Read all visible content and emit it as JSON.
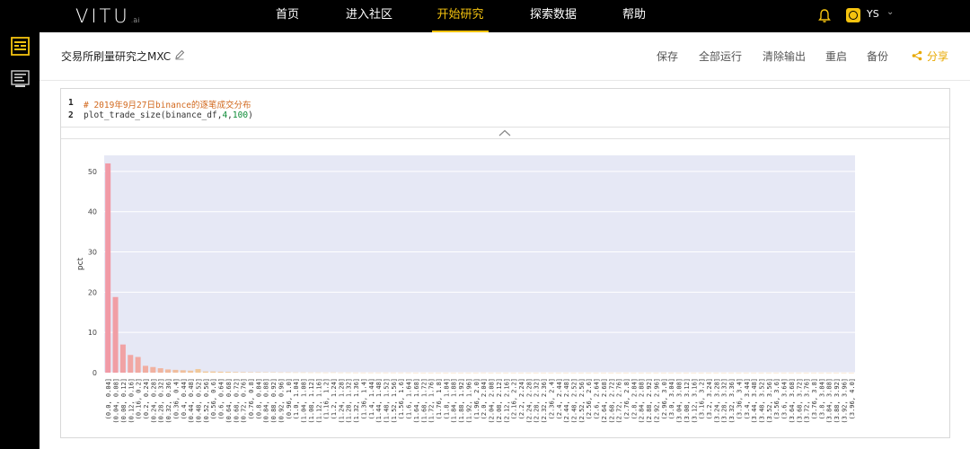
{
  "nav": {
    "logo": "VITU",
    "logo_suffix": ".ai",
    "items": [
      {
        "label": "首页",
        "active": false
      },
      {
        "label": "进入社区",
        "active": false
      },
      {
        "label": "开始研究",
        "active": true
      },
      {
        "label": "探索数据",
        "active": false
      },
      {
        "label": "帮助",
        "active": false
      }
    ],
    "user": "YS",
    "accent": "#f5c30f"
  },
  "sidebar": {
    "icons": [
      "notebook-icon",
      "data-icon"
    ]
  },
  "toolbar": {
    "title": "交易所刷量研究之MXC",
    "save": "保存",
    "run_all": "全部运行",
    "clear_output": "清除输出",
    "restart": "重启",
    "backup": "备份",
    "share": "分享"
  },
  "cell": {
    "lines": [
      {
        "n": "1",
        "comment": "# 2019年9月27日binance的逐笔成交分布"
      },
      {
        "n": "2",
        "pre": "plot_trade_size(binance_df,",
        "num1": "4",
        "comma": ",",
        "num2": "100",
        "post": ")"
      }
    ]
  },
  "chart_data": {
    "type": "bar",
    "ylabel": "pct",
    "ylim": [
      0,
      54
    ],
    "yticks": [
      0,
      10,
      20,
      30,
      40,
      50
    ],
    "bar_color_start": "#f19aa6",
    "bar_color_end": "#f0c89a",
    "plot_bg": "#e6e8f5",
    "categories": [
      "(0.0, 0.04]",
      "(0.04, 0.08]",
      "(0.08, 0.12]",
      "(0.12, 0.16]",
      "(0.16, 0.2]",
      "(0.2, 0.24]",
      "(0.24, 0.28]",
      "(0.28, 0.32]",
      "(0.32, 0.36]",
      "(0.36, 0.4]",
      "(0.4, 0.44]",
      "(0.44, 0.48]",
      "(0.48, 0.52]",
      "(0.52, 0.56]",
      "(0.56, 0.6]",
      "(0.6, 0.64]",
      "(0.64, 0.68]",
      "(0.68, 0.72]",
      "(0.72, 0.76]",
      "(0.76, 0.8]",
      "(0.8, 0.84]",
      "(0.84, 0.88]",
      "(0.88, 0.92]",
      "(0.92, 0.96]",
      "(0.96, 1.0]",
      "(1.0, 1.04]",
      "(1.04, 1.08]",
      "(1.08, 1.12]",
      "(1.12, 1.16]",
      "(1.16, 1.2]",
      "(1.2, 1.24]",
      "(1.24, 1.28]",
      "(1.28, 1.32]",
      "(1.32, 1.36]",
      "(1.36, 1.4]",
      "(1.4, 1.44]",
      "(1.44, 1.48]",
      "(1.48, 1.52]",
      "(1.52, 1.56]",
      "(1.56, 1.6]",
      "(1.6, 1.64]",
      "(1.64, 1.68]",
      "(1.68, 1.72]",
      "(1.72, 1.76]",
      "(1.76, 1.8]",
      "(1.8, 1.84]",
      "(1.84, 1.88]",
      "(1.88, 1.92]",
      "(1.92, 1.96]",
      "(1.96, 2.0]",
      "(2.0, 2.04]",
      "(2.04, 2.08]",
      "(2.08, 2.12]",
      "(2.12, 2.16]",
      "(2.16, 2.2]",
      "(2.2, 2.24]",
      "(2.24, 2.28]",
      "(2.28, 2.32]",
      "(2.32, 2.36]",
      "(2.36, 2.4]",
      "(2.4, 2.44]",
      "(2.44, 2.48]",
      "(2.48, 2.52]",
      "(2.52, 2.56]",
      "(2.56, 2.6]",
      "(2.6, 2.64]",
      "(2.64, 2.68]",
      "(2.68, 2.72]",
      "(2.72, 2.76]",
      "(2.76, 2.8]",
      "(2.8, 2.84]",
      "(2.84, 2.88]",
      "(2.88, 2.92]",
      "(2.92, 2.96]",
      "(2.96, 3.0]",
      "(3.0, 3.04]",
      "(3.04, 3.08]",
      "(3.08, 3.12]",
      "(3.12, 3.16]",
      "(3.16, 3.2]",
      "(3.2, 3.24]",
      "(3.24, 3.28]",
      "(3.28, 3.32]",
      "(3.32, 3.36]",
      "(3.36, 3.4]",
      "(3.4, 3.44]",
      "(3.44, 3.48]",
      "(3.48, 3.52]",
      "(3.52, 3.56]",
      "(3.56, 3.6]",
      "(3.6, 3.64]",
      "(3.64, 3.68]",
      "(3.68, 3.72]",
      "(3.72, 3.76]",
      "(3.76, 3.8]",
      "(3.8, 3.84]",
      "(3.84, 3.88]",
      "(3.88, 3.92]",
      "(3.92, 3.96]",
      "(3.96, 4.0]"
    ],
    "values": [
      52,
      18.8,
      7,
      4.4,
      3.9,
      1.7,
      1.4,
      1.1,
      0.8,
      0.7,
      0.6,
      0.5,
      0.9,
      0.3,
      0.3,
      0.25,
      0.2,
      0.15,
      0.12,
      0.1,
      0.1,
      0.08,
      0.08,
      0.06,
      0.06,
      0.05,
      0.05,
      0.04,
      0.04,
      0.03,
      0.05,
      0.03,
      0.03,
      0.02,
      0.02,
      0.02,
      0.02,
      0.02,
      0.02,
      0.02,
      0.02,
      0.01,
      0.01,
      0.01,
      0.01,
      0.01,
      0.01,
      0.01,
      0.01,
      0.01,
      0.02,
      0.01,
      0.01,
      0.01,
      0.01,
      0.01,
      0.01,
      0.01,
      0.01,
      0.01,
      0.01,
      0.01,
      0.01,
      0.01,
      0.01,
      0.01,
      0.01,
      0.01,
      0.01,
      0.01,
      0.01,
      0.01,
      0.01,
      0.01,
      0.01,
      0.01,
      0.01,
      0.01,
      0.01,
      0.01,
      0.01,
      0.01,
      0.01,
      0.01,
      0.01,
      0.01,
      0.01,
      0.01,
      0.01,
      0.01,
      0.01,
      0.01,
      0.01,
      0.01,
      0.01,
      0.01,
      0.01,
      0.01,
      0.01,
      0.01
    ]
  }
}
